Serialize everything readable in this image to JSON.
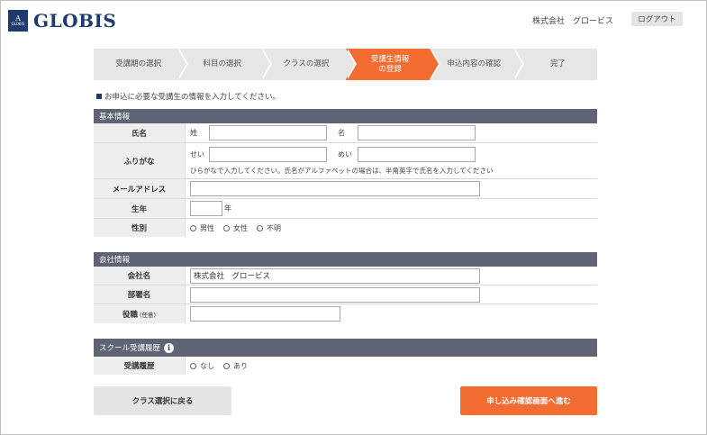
{
  "header": {
    "logo_text": "GLOBIS",
    "logo_mark_text": "GLOBIS",
    "company": "株式会社　グロービス",
    "logout_label": "ログアウト"
  },
  "steps": [
    {
      "label": "受講期の選択",
      "active": false
    },
    {
      "label": "科目の選択",
      "active": false
    },
    {
      "label": "クラスの選択",
      "active": false
    },
    {
      "label": "受講生情報\nの登録",
      "active": true
    },
    {
      "label": "申込内容の確認",
      "active": false
    },
    {
      "label": "完了",
      "active": false
    }
  ],
  "notice": "お申込に必要な受講生の情報を入力してください。",
  "basic": {
    "title": "基本情報",
    "name_label": "氏名",
    "sei_label": "姓",
    "mei_label": "名",
    "sei_value": "",
    "mei_value": "",
    "furigana_label": "ふりがな",
    "sei_kana_label": "せい",
    "mei_kana_label": "めい",
    "sei_kana_value": "",
    "mei_kana_value": "",
    "furigana_note": "ひらがなで入力してください。氏名がアルファベットの場合は、半角英字で氏名を入力してください",
    "email_label": "メールアドレス",
    "email_value": "",
    "birth_label": "生年",
    "birth_value": "",
    "birth_unit": "年",
    "gender_label": "性別",
    "gender_options": [
      "男性",
      "女性",
      "不明"
    ]
  },
  "company": {
    "title": "会社情報",
    "company_label": "会社名",
    "company_value": "株式会社　グロービス",
    "dept_label": "部署名",
    "dept_value": "",
    "position_label": "役職",
    "position_optional": "(任意)",
    "position_value": ""
  },
  "history": {
    "title": "スクール受講履歴",
    "info_icon": "i",
    "label": "受講履歴",
    "options": [
      "なし",
      "あり"
    ]
  },
  "buttons": {
    "back": "クラス選択に戻る",
    "next": "申し込み確認画面へ進む"
  }
}
